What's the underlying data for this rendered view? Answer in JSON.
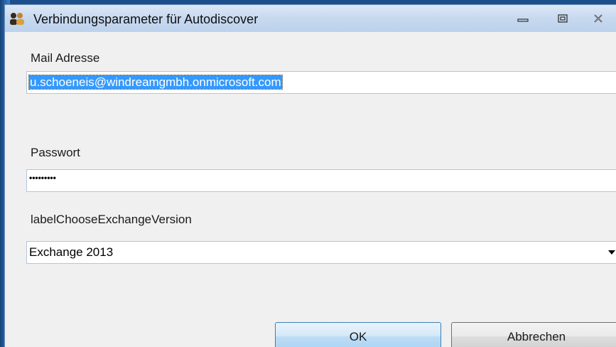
{
  "window": {
    "title": "Verbindungsparameter für Autodiscover",
    "icon": "autodiscover-people-icon",
    "controls": [
      "minimize-icon",
      "maximize-icon",
      "close-icon"
    ]
  },
  "form": {
    "mail_label": "Mail Adresse",
    "mail_value": "u.schoeneis@windreamgmbh.onmicrosoft.com",
    "password_label": "Passwort",
    "password_value": "•••••••••",
    "exchange_label": "labelChooseExchangeVersion",
    "exchange_selected": "Exchange 2013"
  },
  "buttons": {
    "ok_label": "OK",
    "cancel_label": "Abbrechen"
  },
  "colors": {
    "selection": "#3399ff",
    "titlebar": "#c7d9ef",
    "desktop": "#1f5fa3"
  }
}
